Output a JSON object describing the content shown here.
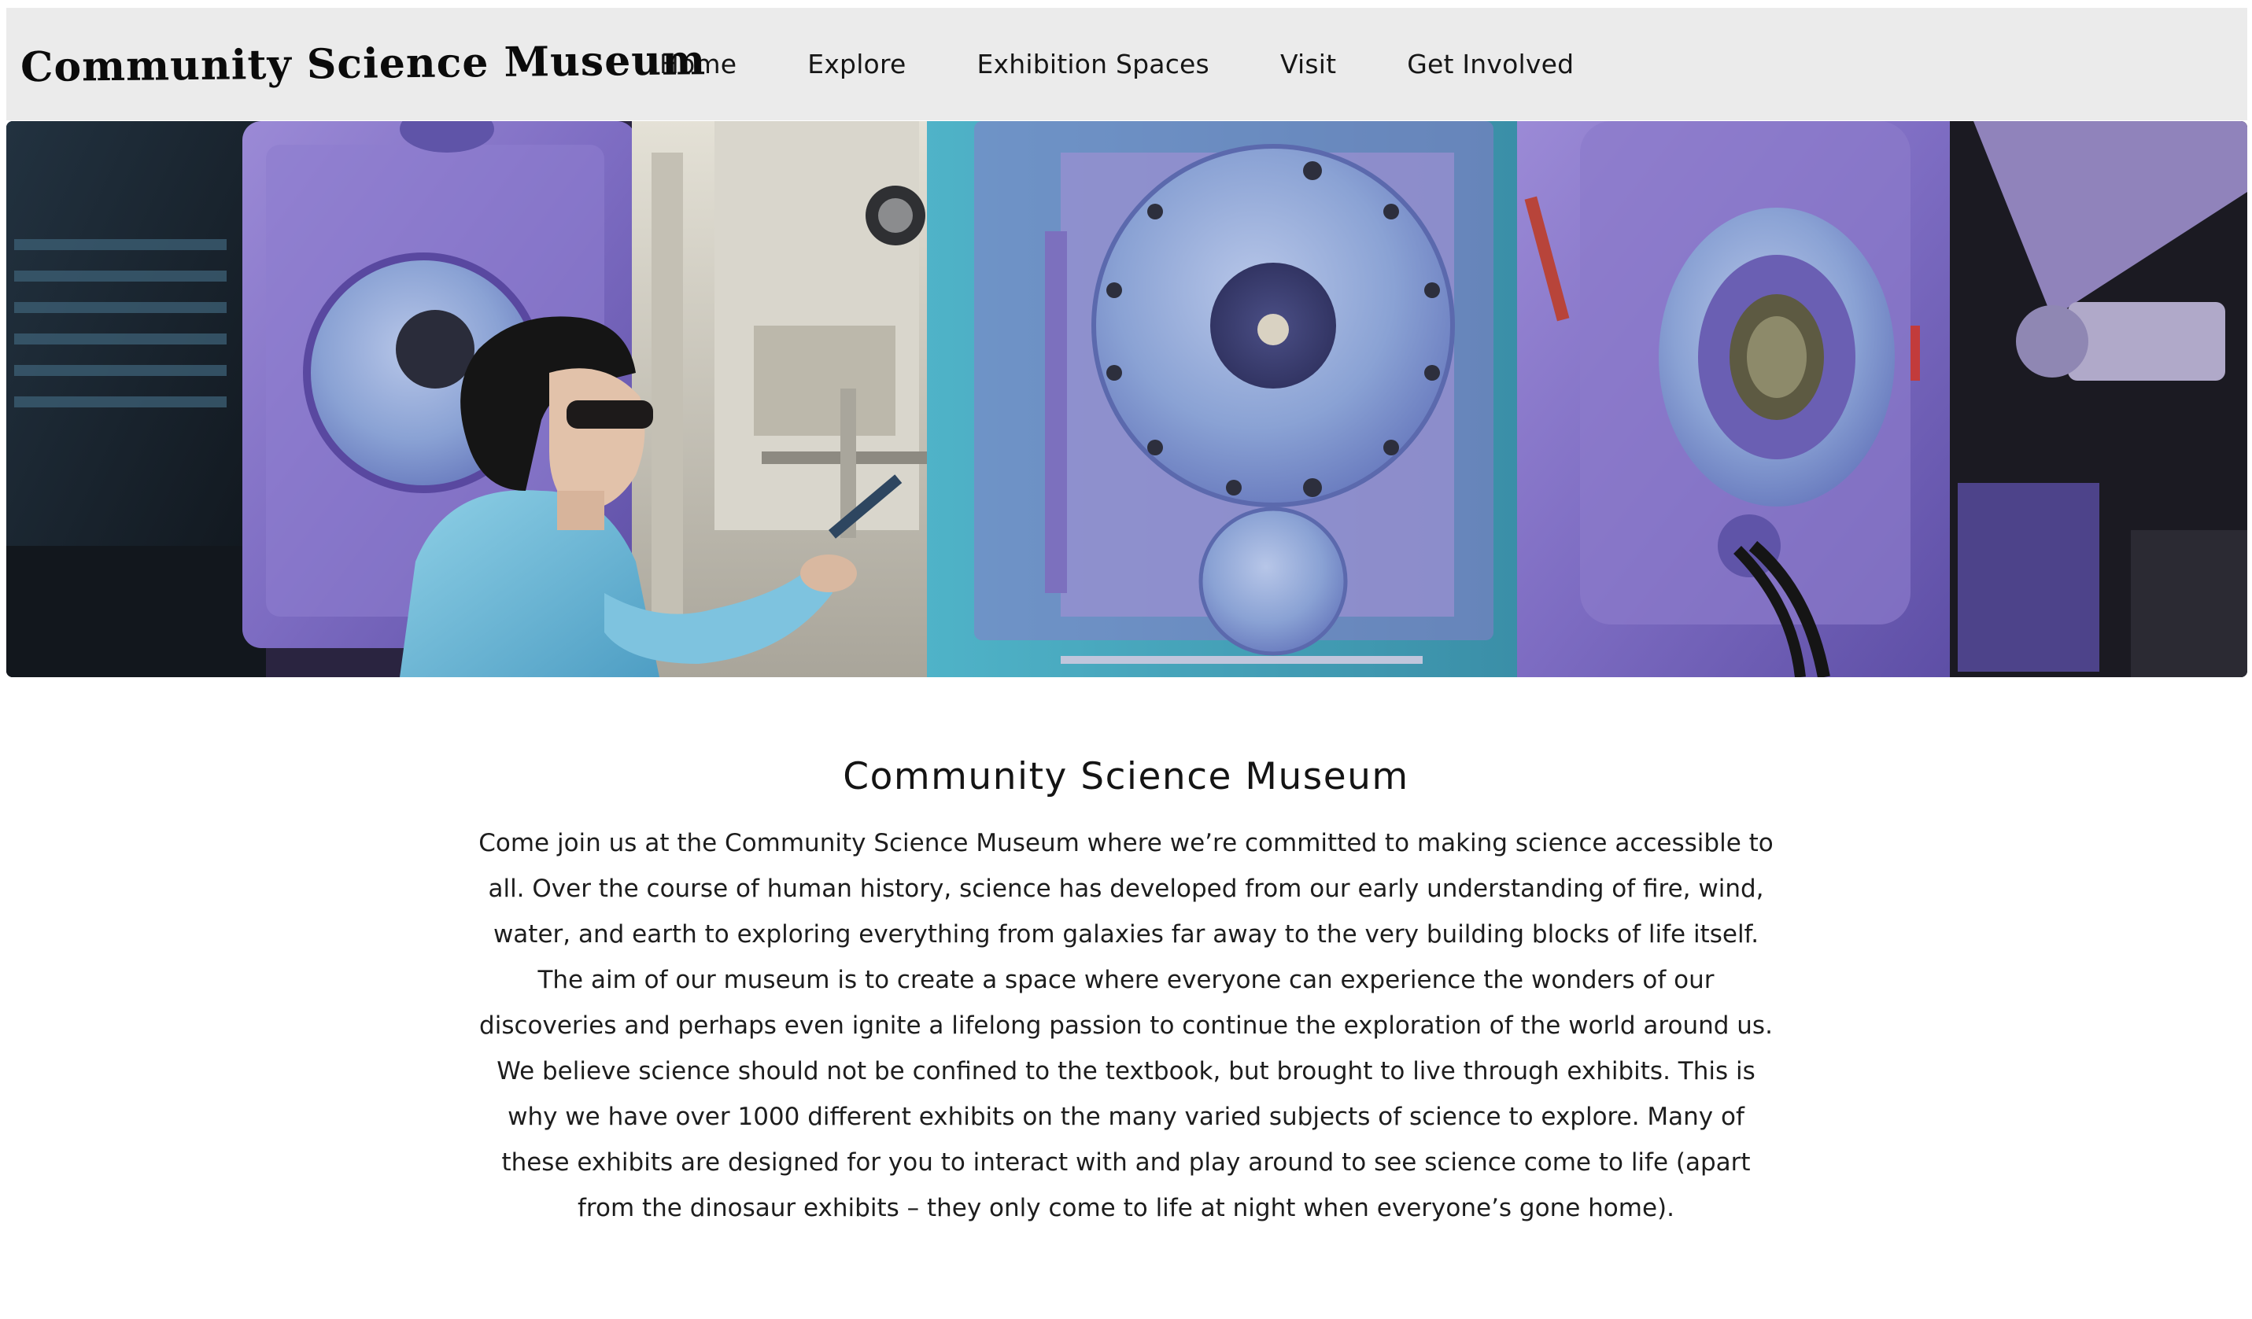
{
  "header": {
    "logo_text": "Community Science Museum",
    "nav": [
      {
        "label": "Home"
      },
      {
        "label": "Explore"
      },
      {
        "label": "Exhibition Spaces"
      },
      {
        "label": "Visit"
      },
      {
        "label": "Get Involved"
      }
    ],
    "background_color": "#ebebeb"
  },
  "hero": {
    "image_subject": "scientist-with-laboratory-machinery-photo",
    "dominant_colors": [
      "#7e6fc4",
      "#4ea9c0",
      "#1c1a24"
    ]
  },
  "intro": {
    "title": "Community Science Museum",
    "body": "Come join us at the Community Science Museum where we’re committed to making science accessible to all. Over the course of human history, science has developed from our early understanding of fire, wind, water, and earth to exploring everything from galaxies far away to the very building blocks of life itself. The aim of our museum is to create a space where everyone can experience the wonders of our discoveries and perhaps even ignite a lifelong passion to continue the exploration of the world around us. We believe science should not be confined to the textbook, but brought to live through exhibits. This is why we have over 1000 different exhibits on the many varied subjects of science to explore. Many of these exhibits are designed for you to interact with and play around to see science come to life (apart from the dinosaur exhibits – they only come to life at night when everyone’s gone home)."
  }
}
